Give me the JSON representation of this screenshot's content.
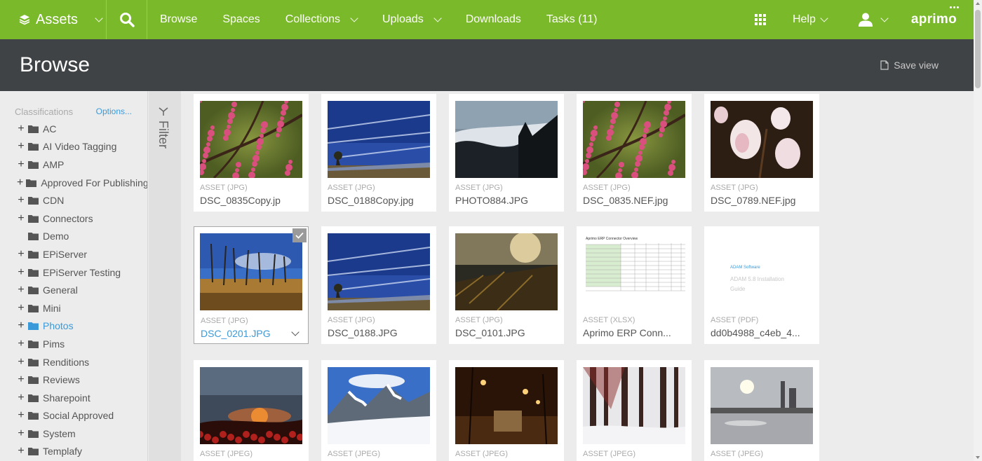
{
  "topnav": {
    "brand_label": "Assets",
    "brand_icon": "layers-icon",
    "search_icon": "search-icon",
    "items": [
      {
        "label": "Browse",
        "has_menu": false
      },
      {
        "label": "Spaces",
        "has_menu": false
      },
      {
        "label": "Collections",
        "has_menu": true
      },
      {
        "label": "Uploads",
        "has_menu": true
      },
      {
        "label": "Downloads",
        "has_menu": false
      },
      {
        "label": "Tasks (11)",
        "has_menu": false
      }
    ],
    "apps_icon": "apps-grid-icon",
    "help_label": "Help",
    "user_icon": "user-icon",
    "logo_text": "aprimo",
    "accent": "#7ab929"
  },
  "header": {
    "title": "Browse",
    "save_view_label": "Save view",
    "background": "#404346"
  },
  "sidebar": {
    "label": "Classifications",
    "options_label": "Options...",
    "items": [
      {
        "label": "AC",
        "expandable": true,
        "active": false
      },
      {
        "label": "AI Video Tagging",
        "expandable": true,
        "active": false
      },
      {
        "label": "AMP",
        "expandable": true,
        "active": false
      },
      {
        "label": "Approved For Publishing",
        "expandable": true,
        "active": false
      },
      {
        "label": "CDN",
        "expandable": true,
        "active": false
      },
      {
        "label": "Connectors",
        "expandable": true,
        "active": false
      },
      {
        "label": "Demo",
        "expandable": false,
        "active": false
      },
      {
        "label": "EPiServer",
        "expandable": true,
        "active": false
      },
      {
        "label": "EPiServer Testing",
        "expandable": true,
        "active": false
      },
      {
        "label": "General",
        "expandable": true,
        "active": false
      },
      {
        "label": "Mini",
        "expandable": true,
        "active": false
      },
      {
        "label": "Photos",
        "expandable": true,
        "active": true
      },
      {
        "label": "Pims",
        "expandable": true,
        "active": false
      },
      {
        "label": "Renditions",
        "expandable": true,
        "active": false
      },
      {
        "label": "Reviews",
        "expandable": true,
        "active": false
      },
      {
        "label": "Sharepoint",
        "expandable": true,
        "active": false
      },
      {
        "label": "Social Approved",
        "expandable": true,
        "active": false
      },
      {
        "label": "System",
        "expandable": true,
        "active": false
      },
      {
        "label": "Templafy",
        "expandable": true,
        "active": false
      }
    ]
  },
  "filter": {
    "label": "Filter"
  },
  "assets": [
    {
      "type": "ASSET (JPG)",
      "name": "DSC_0835Copy.jp",
      "thumb": "blossom",
      "selected": false
    },
    {
      "type": "ASSET (JPG)",
      "name": "DSC_0188Copy.jpg",
      "thumb": "sky",
      "selected": false
    },
    {
      "type": "ASSET (JPG)",
      "name": "PHOTO884.JPG",
      "thumb": "fog",
      "selected": false
    },
    {
      "type": "ASSET (JPG)",
      "name": "DSC_0835.NEF.jpg",
      "thumb": "blossom",
      "selected": false
    },
    {
      "type": "ASSET (JPG)",
      "name": "DSC_0789.NEF.jpg",
      "thumb": "magnolia",
      "selected": false
    },
    {
      "type": "ASSET (JPG)",
      "name": "DSC_0201.JPG",
      "thumb": "deadtrees",
      "selected": true
    },
    {
      "type": "ASSET (JPG)",
      "name": "DSC_0188.JPG",
      "thumb": "sky",
      "selected": false
    },
    {
      "type": "ASSET (JPG)",
      "name": "DSC_0101.JPG",
      "thumb": "sunset-grass",
      "selected": false
    },
    {
      "type": "ASSET (XLSX)",
      "name": "Aprimo ERP Conn...",
      "thumb": "spreadsheet",
      "selected": false
    },
    {
      "type": "ASSET (PDF)",
      "name": "dd0b4988_c4eb_4...",
      "thumb": "pdf",
      "selected": false
    },
    {
      "type": "ASSET (JPEG)",
      "name": "",
      "thumb": "sunset-red",
      "selected": false
    },
    {
      "type": "ASSET (JPEG)",
      "name": "",
      "thumb": "mountains",
      "selected": false
    },
    {
      "type": "ASSET (JPEG)",
      "name": "",
      "thumb": "night",
      "selected": false
    },
    {
      "type": "ASSET (JPEG)",
      "name": "",
      "thumb": "snowforest",
      "selected": false
    },
    {
      "type": "ASSET (JPEG)",
      "name": "",
      "thumb": "lake",
      "selected": false
    }
  ],
  "pdf_preview": {
    "line1": "ADAM Software",
    "line2": "ADAM 5.8 Installation",
    "line3": "Guide"
  },
  "xlsx_preview": {
    "title": "Aprimo ERP Connector Overview"
  }
}
